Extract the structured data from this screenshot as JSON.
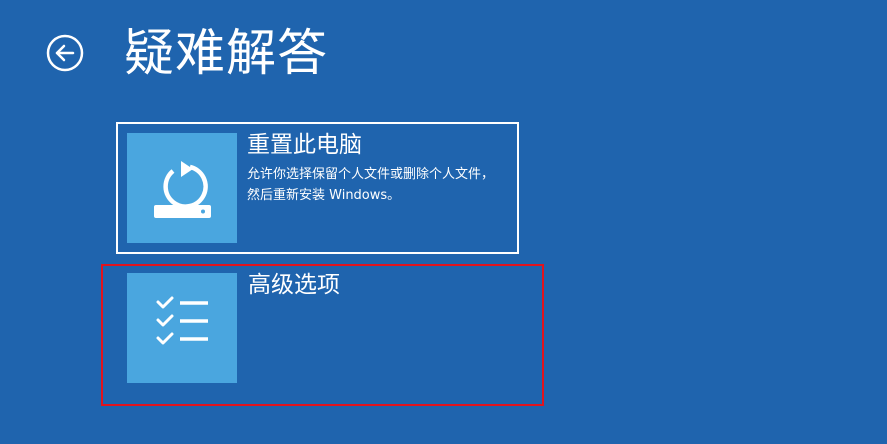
{
  "header": {
    "back_icon": "back-arrow-circle-icon",
    "title": "疑难解答"
  },
  "options": [
    {
      "title": "重置此电脑",
      "description": "允许你选择保留个人文件或删除个人文件，然后重新安装 Windows。",
      "icon": "reset-pc-icon",
      "selected": true
    },
    {
      "title": "高级选项",
      "icon": "checklist-icon",
      "highlighted": true
    }
  ],
  "colors": {
    "background": "#1f64ae",
    "icon_box": "#4aa6df",
    "text": "#ffffff",
    "highlight_border": "#e3141e"
  }
}
